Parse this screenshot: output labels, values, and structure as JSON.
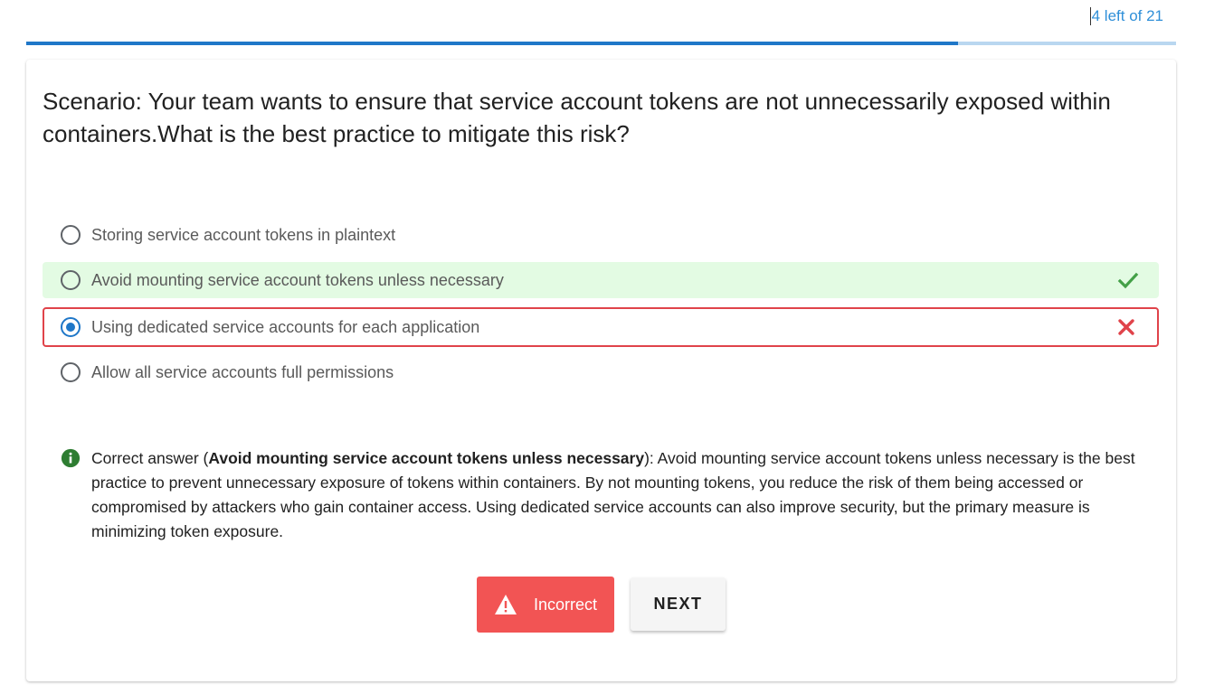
{
  "header": {
    "counter_text": "4 left of 21",
    "progress_fraction": 0.81
  },
  "question": {
    "text": "Scenario: Your team wants to ensure that service account tokens are not unnecessarily exposed within containers.What is the best practice to mitigate this risk?"
  },
  "options": [
    {
      "label": "Storing service account tokens in plaintext",
      "state": "default"
    },
    {
      "label": "Avoid mounting service account tokens unless necessary",
      "state": "correct",
      "icon": "checkmark-icon"
    },
    {
      "label": "Using dedicated service accounts for each application",
      "state": "selected-wrong",
      "icon": "cross-icon"
    },
    {
      "label": "Allow all service accounts full permissions",
      "state": "default"
    }
  ],
  "explanation": {
    "prefix": "Correct answer (",
    "answer": "Avoid mounting service account tokens unless necessary",
    "body": "): Avoid mounting service account tokens unless necessary is the best practice to prevent unnecessary exposure of tokens within containers. By not mounting tokens, you reduce the risk of them being accessed or compromised by attackers who gain container access. Using dedicated service accounts can also improve security, but the primary measure is minimizing token exposure."
  },
  "buttons": {
    "result_label": "Incorrect",
    "next_label": "NEXT"
  },
  "colors": {
    "accent": "#1f77c8",
    "correct_bg": "#e3fbe3",
    "correct_icon": "#43a047",
    "wrong": "#e0434a",
    "incorrect_button": "#f25454",
    "info_icon": "#2e7d32"
  }
}
